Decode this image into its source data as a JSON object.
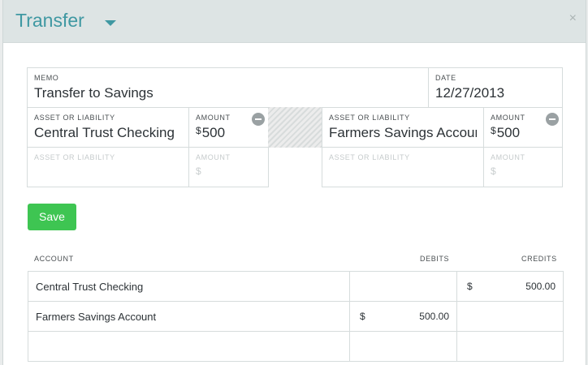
{
  "header": {
    "title": "Transfer",
    "close_symbol": "×"
  },
  "memo": {
    "label": "MEMO",
    "value": "Transfer to Savings"
  },
  "date": {
    "label": "DATE",
    "value": "12/27/2013"
  },
  "left": {
    "asset_label": "ASSET OR LIABILITY",
    "asset_value": "Central Trust Checking",
    "amount_label": "AMOUNT",
    "currency": "$",
    "amount_value": "500",
    "empty_asset_label": "ASSET OR LIABILITY",
    "empty_amount_label": "AMOUNT",
    "empty_currency": "$"
  },
  "right": {
    "asset_label": "ASSET OR LIABILITY",
    "asset_value": "Farmers Savings Account",
    "amount_label": "AMOUNT",
    "currency": "$",
    "amount_value": "500",
    "empty_asset_label": "ASSET OR LIABILITY",
    "empty_amount_label": "AMOUNT",
    "empty_currency": "$"
  },
  "save_label": "Save",
  "table": {
    "headers": {
      "account": "ACCOUNT",
      "debits": "DEBITS",
      "credits": "CREDITS"
    },
    "rows": [
      {
        "account": "Central Trust Checking",
        "debit_currency": "",
        "debit": "",
        "credit_currency": "$",
        "credit": "500.00"
      },
      {
        "account": "Farmers Savings Account",
        "debit_currency": "$",
        "debit": "500.00",
        "credit_currency": "",
        "credit": ""
      },
      {
        "account": "",
        "debit_currency": "",
        "debit": "",
        "credit_currency": "",
        "credit": ""
      }
    ]
  },
  "colors": {
    "accent": "#3f98a2",
    "save": "#3ec552",
    "header_bg": "#dde4e4"
  }
}
